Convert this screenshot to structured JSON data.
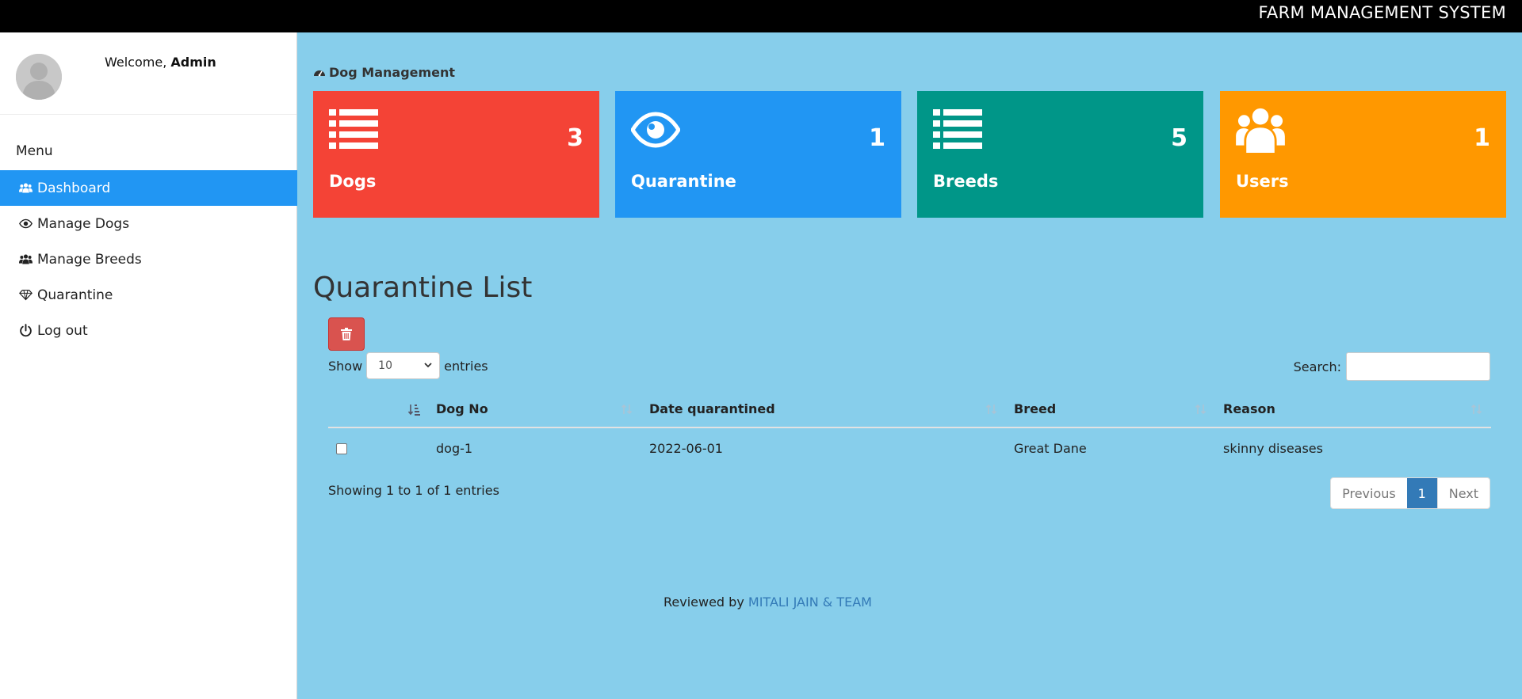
{
  "header": {
    "title": "FARM MANAGEMENT SYSTEM"
  },
  "sidebar": {
    "welcome_prefix": "Welcome,",
    "user_name": "Admin",
    "menu_title": "Menu",
    "items": [
      {
        "label": "Dashboard",
        "icon": "users-icon",
        "active": true
      },
      {
        "label": "Manage Dogs",
        "icon": "eye-icon"
      },
      {
        "label": "Manage Breeds",
        "icon": "users-icon"
      },
      {
        "label": "Quarantine",
        "icon": "diamond-icon"
      },
      {
        "label": "Log out",
        "icon": "power-icon"
      }
    ]
  },
  "breadcrumb": {
    "label": "Dog Management",
    "icon": "dashboard-icon"
  },
  "cards": [
    {
      "label": "Dogs",
      "count": "3",
      "color": "#f44336",
      "icon": "list-icon"
    },
    {
      "label": "Quarantine",
      "count": "1",
      "color": "#2196f3",
      "icon": "eye-icon"
    },
    {
      "label": "Breeds",
      "count": "5",
      "color": "#009688",
      "icon": "list-icon"
    },
    {
      "label": "Users",
      "count": "1",
      "color": "#ff9800",
      "icon": "users-icon"
    }
  ],
  "section": {
    "title": "Quarantine List"
  },
  "table_controls": {
    "show_label": "Show",
    "entries_label": "entries",
    "length_value": "10",
    "search_label": "Search:",
    "search_value": ""
  },
  "table": {
    "columns": [
      "",
      "Dog No",
      "Date quarantined",
      "Breed",
      "Reason"
    ],
    "rows": [
      {
        "dog_no": "dog-1",
        "date": "2022-06-01",
        "breed": "Great Dane",
        "reason": "skinny diseases"
      }
    ],
    "info": "Showing 1 to 1 of 1 entries"
  },
  "pagination": {
    "previous": "Previous",
    "current": "1",
    "next": "Next"
  },
  "footer": {
    "prefix": "Reviewed by",
    "link": "MITALI JAIN & TEAM"
  },
  "colors": {
    "page_bg": "#87ceeb",
    "accent": "#2196f3",
    "danger": "#d9534f",
    "link": "#337ab7"
  }
}
